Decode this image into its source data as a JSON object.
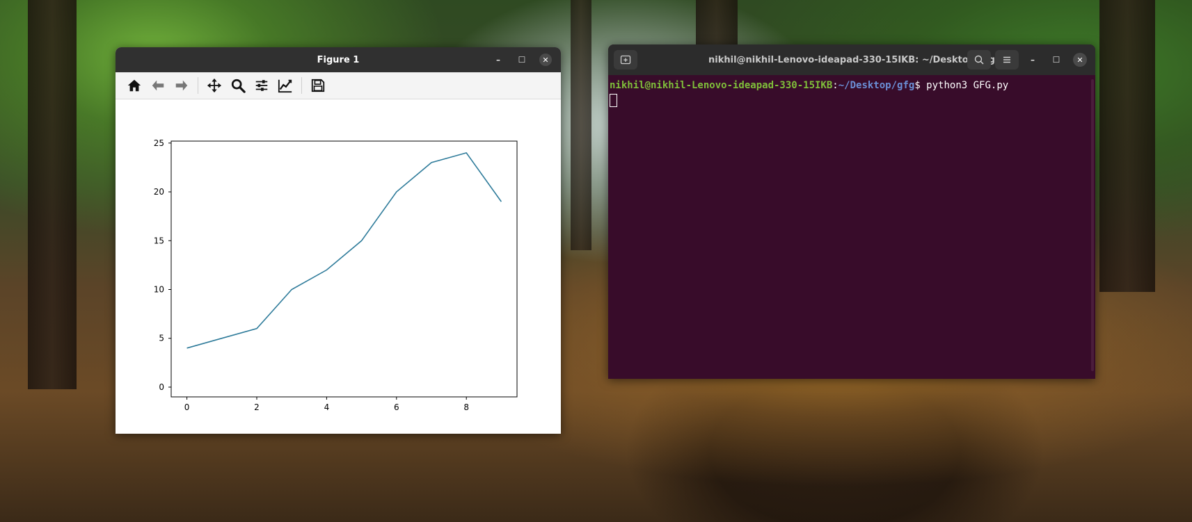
{
  "figure_window": {
    "title": "Figure 1",
    "controls": {
      "minimize": "–",
      "maximize": "☐",
      "close": "✕"
    },
    "toolbar": [
      "home-icon",
      "back-arrow-icon",
      "forward-arrow-icon",
      "pan-icon",
      "zoom-icon",
      "configure-subplots-icon",
      "edit-axis-icon",
      "save-icon"
    ]
  },
  "chart_data": {
    "type": "line",
    "x": [
      0,
      1,
      2,
      3,
      4,
      5,
      6,
      7,
      8,
      9
    ],
    "y": [
      4,
      5,
      6,
      10,
      12,
      15,
      20,
      23,
      24,
      19
    ],
    "xticks": [
      "0",
      "2",
      "4",
      "6",
      "8"
    ],
    "yticks": [
      "0",
      "5",
      "10",
      "15",
      "20",
      "25"
    ],
    "xlim": [
      -0.45,
      9.45
    ],
    "ylim": [
      -1.0,
      25.2
    ],
    "line_color": "#2e7b9a",
    "grid": false
  },
  "terminal": {
    "title": "nikhil@nikhil-Lenovo-ideapad-330-15IKB: ~/Desktop/gfg",
    "prompt_user": "nikhil@nikhil-Lenovo-ideapad-330-15IKB",
    "prompt_sep": ":",
    "prompt_path": "~/Desktop/gfg",
    "prompt_symbol": "$",
    "command": " python3 GFG.py",
    "colors": {
      "background": "#380c2a",
      "user": "#7fbf3a",
      "path": "#6b8fd6"
    }
  }
}
